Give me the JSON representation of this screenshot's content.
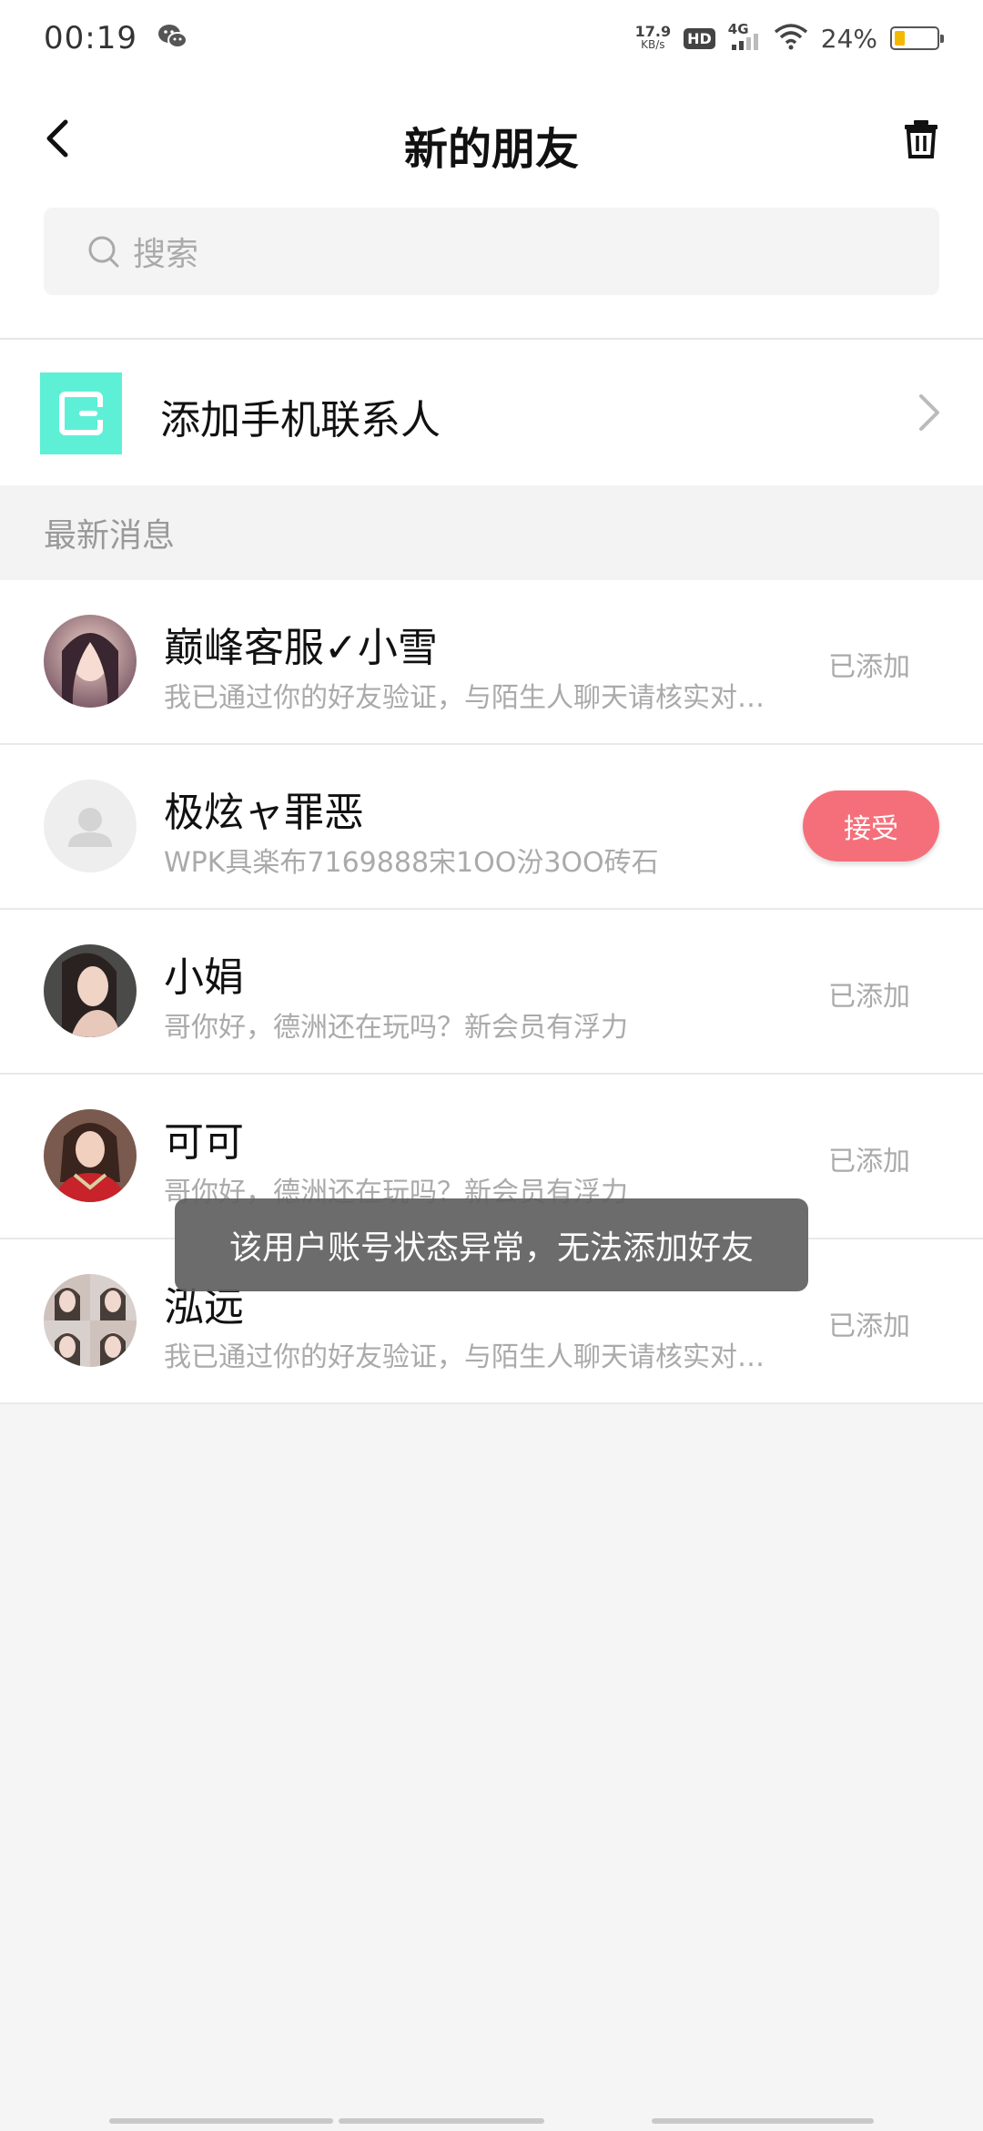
{
  "status_bar": {
    "time": "00:19",
    "net_speed_value": "17.9",
    "net_speed_unit": "KB/s",
    "hd_badge": "HD",
    "network": "4G",
    "battery_percent_text": "24%",
    "battery_level": 0.24,
    "battery_color": "#f5b800",
    "icons": [
      "wechat-icon",
      "hd-icon",
      "signal-icon",
      "wifi-icon",
      "battery-icon"
    ]
  },
  "header": {
    "title": "新的朋友",
    "back_icon": "chevron-left-icon",
    "delete_icon": "trash-icon"
  },
  "search": {
    "placeholder": "搜索",
    "icon": "search-icon"
  },
  "add_contacts": {
    "label": "添加手机联系人",
    "icon_color": "#5ef0d6",
    "icon": "contacts-icon"
  },
  "section": {
    "title": "最新消息"
  },
  "requests": [
    {
      "name": "巅峰客服✓小雪",
      "message": "我已通过你的好友验证，与陌生人聊天请核实对方身份",
      "status": "已添加",
      "avatar": "photo"
    },
    {
      "name": "极炫ャ罪恶",
      "message": "WPK具楽布7169888宋1OO汾3OO砖石",
      "action": "接受",
      "avatar": "default-person"
    },
    {
      "name": "小娟",
      "message": "哥你好，德洲还在玩吗？新会员有浮力",
      "status": "已添加",
      "avatar": "photo"
    },
    {
      "name": "可可",
      "message": "哥你好，德洲还在玩吗？新会员有浮力",
      "status": "已添加",
      "avatar": "photo"
    },
    {
      "name": "泓远",
      "message": "我已通过你的好友验证，与陌生人聊天请核实对方身份",
      "status": "已添加",
      "avatar": "photo-collage"
    }
  ],
  "toast": {
    "message": "该用户账号状态异常，无法添加好友"
  },
  "colors": {
    "accent": "#f56f7a",
    "teal": "#5ef0d6",
    "background": "#f5f5f5"
  }
}
